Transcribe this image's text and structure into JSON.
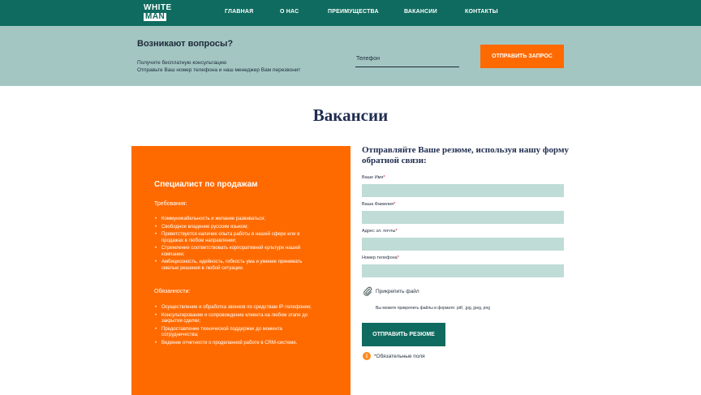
{
  "nav": {
    "logo_line1": "WHITE",
    "logo_line2": "MAN",
    "items": [
      "ГЛАВНАЯ",
      "О НАС",
      "ПРЕИМУЩЕСТВА",
      "ВАКАНСИИ",
      "КОНТАКТЫ"
    ]
  },
  "cta": {
    "title": "Возникают вопросы?",
    "line1": "Получите бесплатную консультацию",
    "line2": "Отправьте Ваш номер телефона и наш менеджер Вам перезвонит",
    "phone_placeholder": "Телефон",
    "button": "ОТПРАВИТЬ ЗАПРОС"
  },
  "page_title": "Вакансии",
  "vacancy": {
    "title": "Специалист по продажам",
    "requirements_head": "Требования:",
    "requirements": [
      "Коммуникабельность и желание развиваться;",
      "Свободное владение русским языком;",
      "Приветствуется наличие опыта работы в нашей сфере или в продажах в любом направлении;",
      "Стремление соответствовать корпоративной культуре нашей компании;",
      "Амбициозность, идейность, гибкость ума и умение принимать смелые решения в любой ситуации."
    ],
    "duties_head": "Обязанности:",
    "duties": [
      "Осуществление и обработка звонков по средствам IP-телефонии;",
      "Консультирование и сопровождение клиента на любом этапе до закрытия сделки;",
      "Предоставление технической поддержки до момента сотрудничества;",
      "Ведение отчетности о проделанной работе в CRM-системе."
    ]
  },
  "form": {
    "title": "Отправляйте Ваше резюме, используя нашу форму обратной связи:",
    "fields": [
      {
        "label": "Ваше Имя",
        "value": ""
      },
      {
        "label": "Ваша Фамилия",
        "value": ""
      },
      {
        "label": "Адрес эл. почты",
        "value": ""
      },
      {
        "label": "Номер телефона",
        "value": ""
      }
    ],
    "required_mark": "*",
    "attach_label": "Прикрепить файл",
    "attach_hint": "Вы можете прикрепить файлы в формате: pdf, .jpg, jpeg, png",
    "submit": "ОТПРАВИТЬ РЕЗЮМЕ",
    "required_note": "*Обязательные поля"
  },
  "colors": {
    "primary": "#0f6b5f",
    "accent": "#ff6a00",
    "cta_bg": "#a3c6c2",
    "input_bg": "#bfdcd7"
  },
  "icons": {
    "attach": "paperclip-icon",
    "info": "info-icon"
  }
}
